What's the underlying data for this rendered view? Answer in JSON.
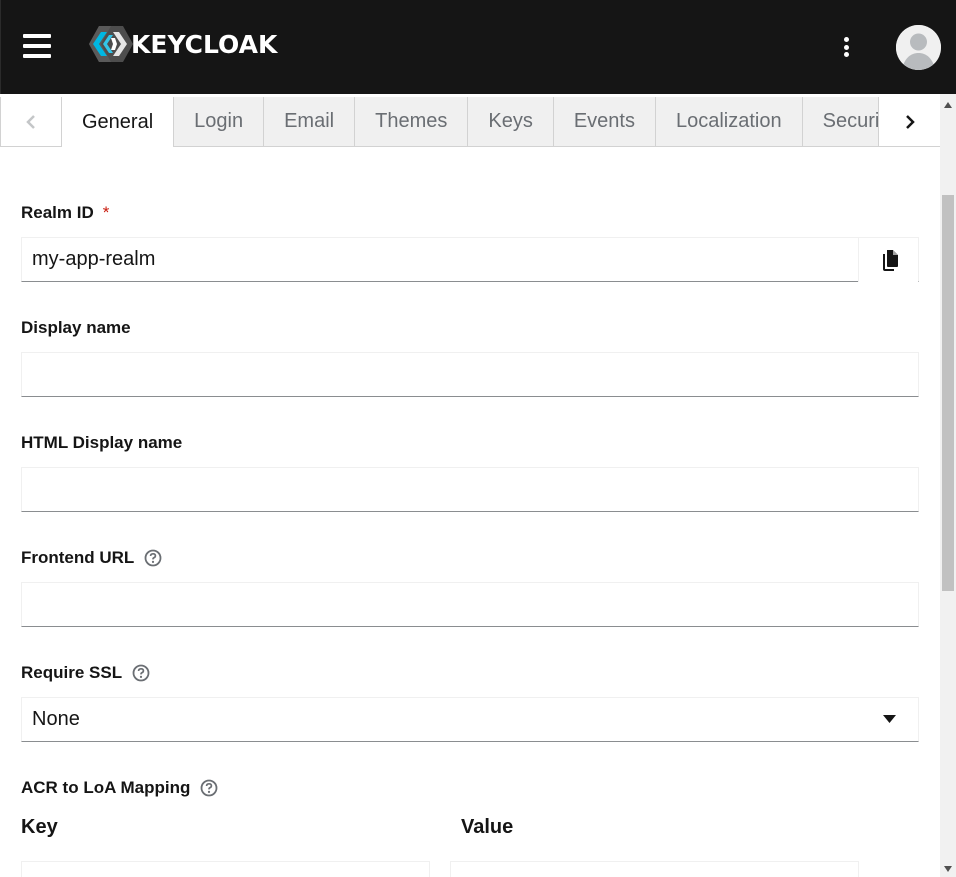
{
  "app": {
    "logo_text": "KEYCLOAK",
    "brand_color": "#151515",
    "accent_color": "#0066cc"
  },
  "tabs": [
    {
      "label": "General",
      "active": true
    },
    {
      "label": "Login"
    },
    {
      "label": "Email"
    },
    {
      "label": "Themes"
    },
    {
      "label": "Keys"
    },
    {
      "label": "Events"
    },
    {
      "label": "Localization"
    },
    {
      "label": "Security defenses"
    }
  ],
  "form": {
    "realm_id": {
      "label": "Realm ID",
      "required_mark": "*",
      "value": "my-app-realm"
    },
    "display_name": {
      "label": "Display name",
      "value": ""
    },
    "html_display_name": {
      "label": "HTML Display name",
      "value": ""
    },
    "frontend_url": {
      "label": "Frontend URL",
      "value": ""
    },
    "require_ssl": {
      "label": "Require SSL",
      "value": "None"
    },
    "acr_mapping": {
      "label": "ACR to LoA Mapping",
      "key_header": "Key",
      "value_header": "Value"
    }
  },
  "icons": {
    "menu": "hamburger-icon",
    "kebab": "kebab-icon",
    "user": "avatar-icon",
    "copy": "copy-icon",
    "help": "question-circle-icon",
    "caret": "caret-down-icon"
  }
}
